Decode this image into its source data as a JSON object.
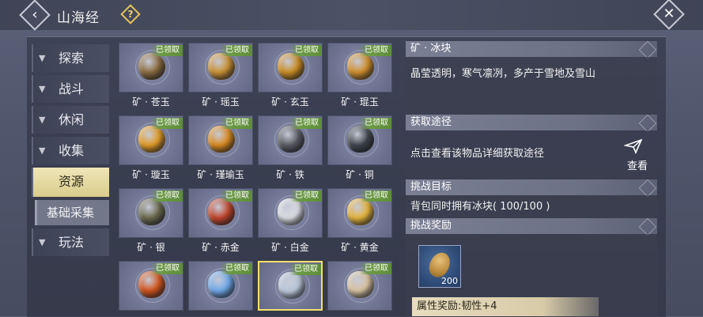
{
  "header": {
    "title": "山海经",
    "back_icon": "back-arrow-icon",
    "help_icon": "help-icon",
    "close_icon": "close-icon"
  },
  "sidebar": {
    "items": [
      {
        "label": "探索",
        "state": "collapsed"
      },
      {
        "label": "战斗",
        "state": "collapsed"
      },
      {
        "label": "休闲",
        "state": "collapsed"
      },
      {
        "label": "收集",
        "state": "collapsed"
      },
      {
        "label": "资源",
        "state": "active"
      },
      {
        "label": "基础采集",
        "state": "sub"
      },
      {
        "label": "玩法",
        "state": "collapsed"
      }
    ]
  },
  "grid": {
    "badge": "已领取",
    "items": [
      {
        "name": "矿 · 苍玉",
        "color": "#8a6a3e"
      },
      {
        "name": "矿 · 瑶玉",
        "color": "#c99032"
      },
      {
        "name": "矿 · 玄玉",
        "color": "#c98b22"
      },
      {
        "name": "矿 · 琨玉",
        "color": "#cf8d2a"
      },
      {
        "name": "矿 · 璇玉",
        "color": "#e09a24"
      },
      {
        "name": "矿 · 瑾瑜玉",
        "color": "#d98a1e"
      },
      {
        "name": "矿 · 铁",
        "color": "#5a5c62"
      },
      {
        "name": "矿 · 铜",
        "color": "#3f444c"
      },
      {
        "name": "矿 · 银",
        "color": "#6b6a4e"
      },
      {
        "name": "矿 · 赤金",
        "color": "#c0452a"
      },
      {
        "name": "矿 · 白金",
        "color": "#d9dbe1"
      },
      {
        "name": "矿 · 黄金",
        "color": "#e3b23a"
      },
      {
        "name": "",
        "color": "#d2551c"
      },
      {
        "name": "",
        "color": "#6fa8e8"
      },
      {
        "name": "",
        "color": "#b9c6d8"
      },
      {
        "name": "",
        "color": "#d6c2a0"
      }
    ]
  },
  "detail": {
    "item_title": "矿 · 冰块",
    "description": "晶莹透明，寒气凛冽，多产于雪地及雪山",
    "source_title": "获取途径",
    "source_text": "点击查看该物品详细获取途径",
    "view_label": "查看",
    "view_icon": "send-icon",
    "goal_title": "挑战目标",
    "goal_text": "背包同时拥有冰块( 100/100 )",
    "reward_title": "挑战奖励",
    "reward_qty": "200",
    "reward_icon": "seed-icon",
    "attr_text": "属性奖励:韧性+4"
  }
}
